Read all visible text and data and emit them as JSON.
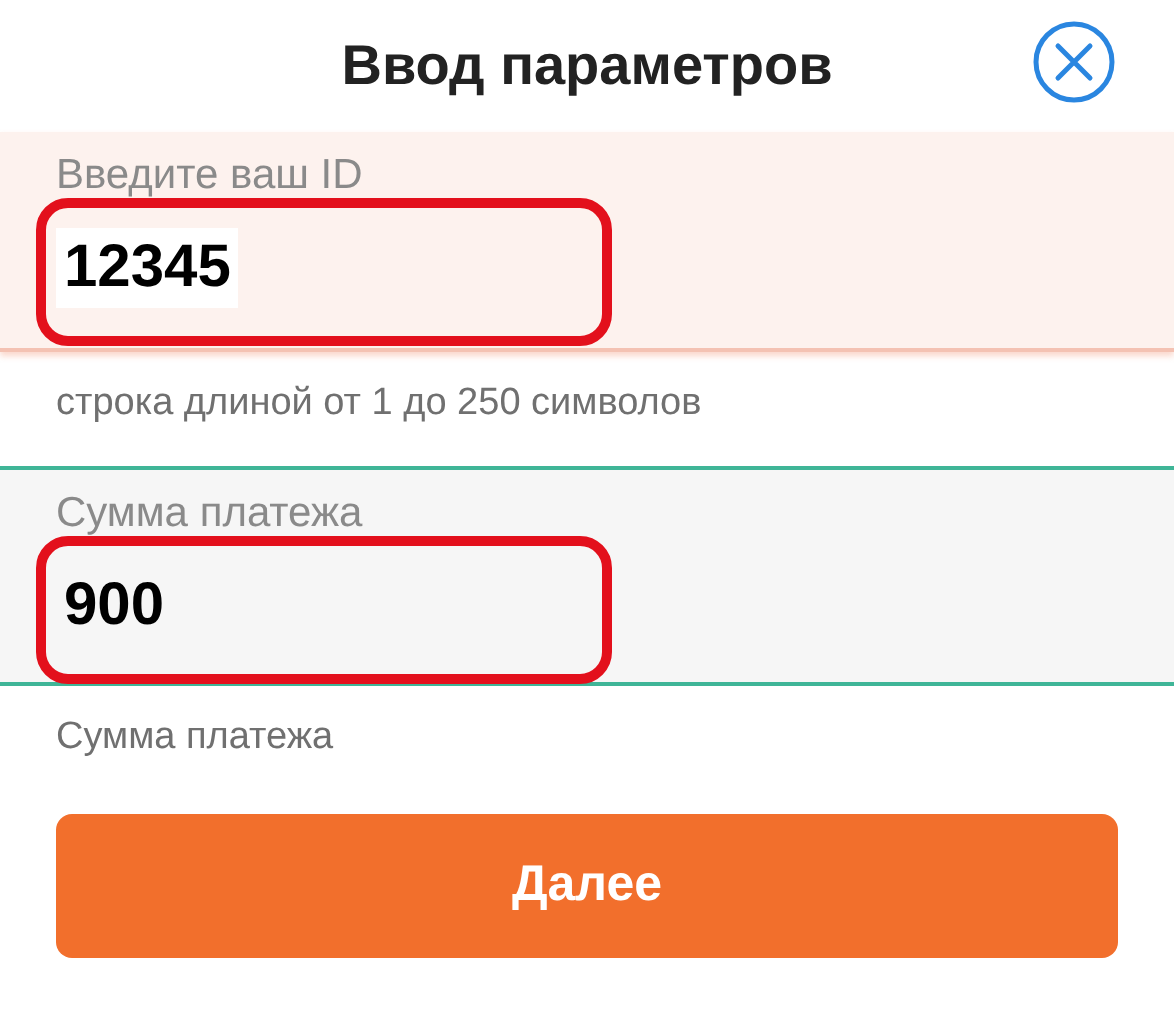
{
  "header": {
    "title": "Ввод параметров"
  },
  "fields": [
    {
      "kind": "focused",
      "label": "Введите ваш ID",
      "value": "12345",
      "hint": "строка длиной от 1 до 250 символов",
      "highlighted": true
    },
    {
      "kind": "plain",
      "label": "Сумма платежа",
      "value": "900",
      "hint": "Сумма платежа",
      "highlighted": true
    }
  ],
  "submit": {
    "label": "Далее"
  }
}
